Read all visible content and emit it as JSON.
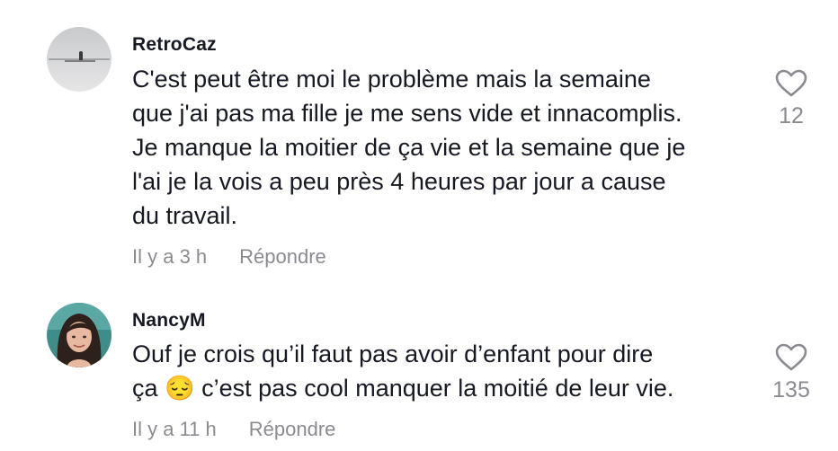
{
  "comments": [
    {
      "username": "RetroCaz",
      "text": "C'est peut être moi le problème mais la semaine\nque j'ai pas ma fille je me sens vide et innacomplis.\nJe manque la moitier de ça vie et la semaine que je\nl'ai je la vois a peu près 4 heures par jour a cause\ndu travail.",
      "time": "Il y a 3 h",
      "reply_label": "Répondre",
      "likes": "12",
      "like_icon": "heart-outline-icon"
    },
    {
      "username": "NancyM",
      "text": "Ouf je crois qu’il faut pas avoir d’enfant pour dire\nça 😔 c’est pas cool manquer la moitié de leur vie.",
      "time": "Il y a 11 h",
      "reply_label": "Répondre",
      "likes": "135",
      "like_icon": "heart-outline-icon"
    }
  ],
  "colors": {
    "primary_text": "#161823",
    "secondary_text": "#8a8b91"
  }
}
